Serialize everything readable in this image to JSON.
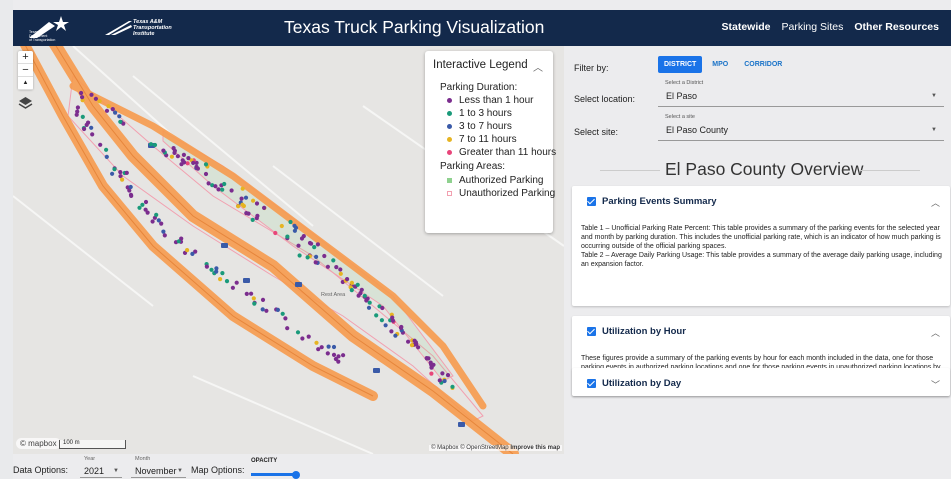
{
  "header": {
    "title": "Texas Truck Parking Visualization",
    "logo_tti_text": [
      "Texas A&M",
      "Transportation",
      "Institute"
    ],
    "logo_txdot_text": [
      "Texas",
      "Department",
      "of Transportation"
    ],
    "nav": [
      {
        "label": "Statewide",
        "bold": true
      },
      {
        "label": "Parking Sites",
        "bold": false
      },
      {
        "label": "Other Resources",
        "bold": true
      }
    ],
    "bg_color": "#13294b"
  },
  "map": {
    "controls": {
      "zoom_in": "+",
      "zoom_out": "−",
      "compass": "▲"
    },
    "legend": {
      "title": "Interactive Legend",
      "duration_heading": "Parking Duration:",
      "durations": [
        {
          "label": "Less than 1 hour",
          "color": "#7b2d8e"
        },
        {
          "label": "1 to 3 hours",
          "color": "#1a9a7a"
        },
        {
          "label": "3 to 7 hours",
          "color": "#3a5aa8"
        },
        {
          "label": "7 to 11 hours",
          "color": "#e6b422"
        },
        {
          "label": "Greater than 11 hours",
          "color": "#e8457a"
        }
      ],
      "areas_heading": "Parking Areas:",
      "areas": [
        {
          "label": "Authorized Parking",
          "color": "#8fd18f"
        },
        {
          "label": "Unauthorized Parking",
          "color": "#f2a0b0"
        }
      ]
    },
    "scale_label": "100 m",
    "mapbox_label": "© mapbox",
    "attribution": "© Mapbox © OpenStreetMap",
    "attribution_link": "Improve this map",
    "road_labels": [
      "Rest Area"
    ]
  },
  "filters": {
    "filter_by_label": "Filter by:",
    "filter_buttons": [
      {
        "label": "DISTRICT",
        "active": true
      },
      {
        "label": "MPO",
        "active": false
      },
      {
        "label": "CORRIDOR",
        "active": false
      }
    ],
    "location_label": "Select location:",
    "location_caption": "Select a District",
    "location_value": "El Paso",
    "site_label": "Select site:",
    "site_caption": "Select a site",
    "site_value": "El Paso County"
  },
  "overview_title": "El Paso County Overview",
  "panels": [
    {
      "title": "Parking Events Summary",
      "expanded": true,
      "body": [
        "Table 1 – Unofficial Parking Rate Percent: This table provides a summary of the parking events for the selected year and month by parking duration. This includes the unofficial parking rate, which is an indicator of how much parking is occurring outside of the official parking spaces.",
        "Table 2 – Average Daily Parking Usage: This table provides a summary of the average daily parking usage, including an expansion factor."
      ]
    },
    {
      "title": "Utilization by Hour",
      "expanded": true,
      "body": [
        "These figures provide a summary of the parking events by hour for each month included in the data, one for those parking events in authorized parking locations and one for those parking events in unauthorized parking locations by parking duration (selection above the figures)."
      ]
    },
    {
      "title": "Utilization by Day",
      "expanded": false,
      "body": []
    }
  ],
  "bottom": {
    "data_options_label": "Data Options:",
    "year_caption": "Year",
    "year_value": "2021",
    "month_caption": "Month",
    "month_value": "November",
    "map_options_label": "Map Options:",
    "opacity_label": "OPACITY",
    "opacity_value": 0.75
  },
  "accent_color": "#1a73e8"
}
